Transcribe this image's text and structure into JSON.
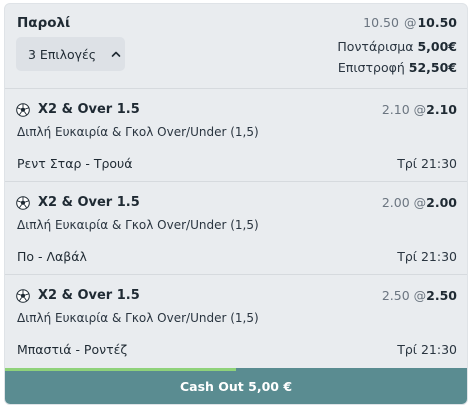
{
  "bet": {
    "type_label": "Παρολί",
    "selections_button": "3 Επιλογές",
    "original_odds": "10.50",
    "at": "@",
    "current_odds": "10.50",
    "stake_label": "Ποντάρισμα",
    "stake_value": "5,00€",
    "return_label": "Επιστροφή",
    "return_value": "52,50€"
  },
  "selections": [
    {
      "icon": "soccer-ball-icon",
      "market": "X2 & Over 1.5",
      "description": "Διπλή Ευκαιρία & Γκολ Over/Under (1,5)",
      "odds_original": "2.10",
      "at": "@",
      "odds_current": "2.10",
      "event": "Ρεντ Σταρ - Τρουά",
      "time": "Τρί 21:30"
    },
    {
      "icon": "soccer-ball-icon",
      "market": "X2 & Over 1.5",
      "description": "Διπλή Ευκαιρία & Γκολ Over/Under (1,5)",
      "odds_original": "2.00",
      "at": "@",
      "odds_current": "2.00",
      "event": "Πο - Λαβάλ",
      "time": "Τρί 21:30"
    },
    {
      "icon": "soccer-ball-icon",
      "market": "X2 & Over 1.5",
      "description": "Διπλή Ευκαιρία & Γκολ Over/Under (1,5)",
      "odds_original": "2.50",
      "at": "@",
      "odds_current": "2.50",
      "event": "Μπαστιά - Ροντέζ",
      "time": "Τρί 21:30"
    }
  ],
  "cashout": {
    "label": "Cash Out 5,00 €",
    "progress_fraction": 0.5,
    "progress_color": "#8fd27a",
    "button_color": "#5a8c91"
  }
}
